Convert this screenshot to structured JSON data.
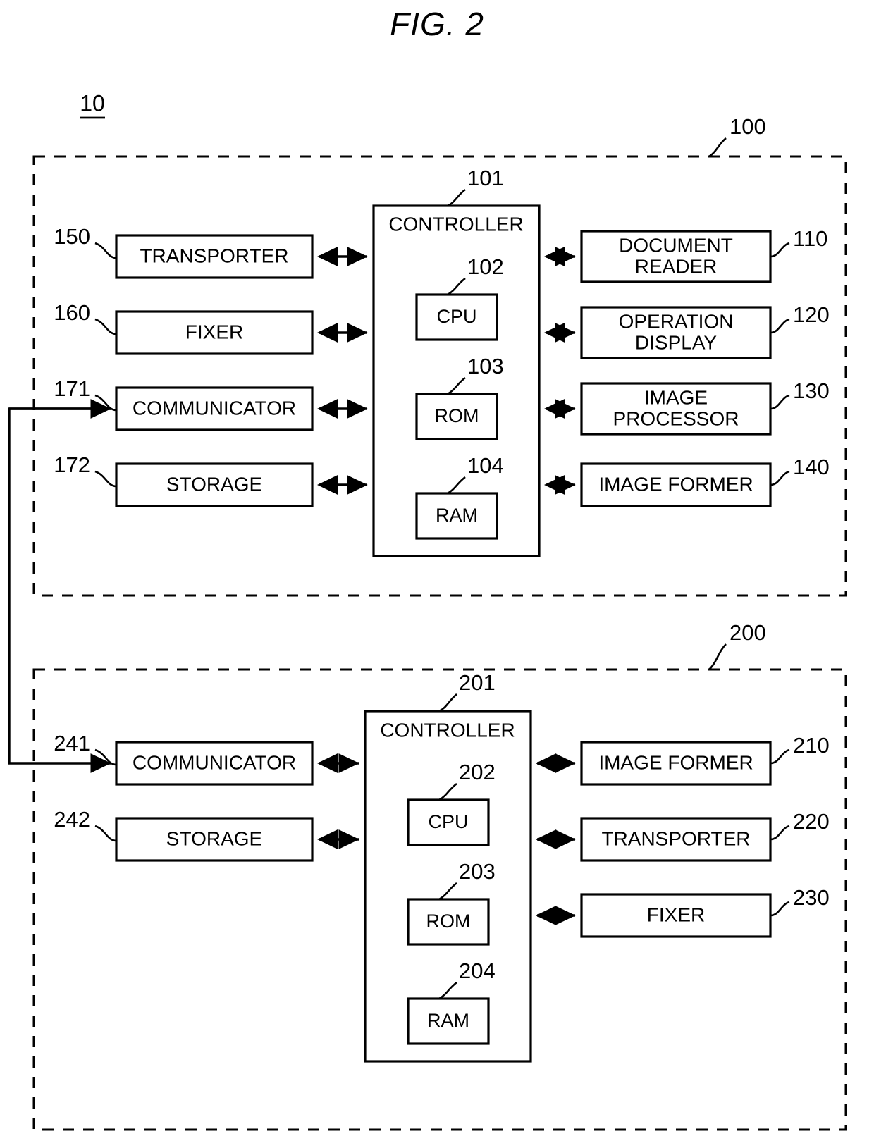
{
  "figure": {
    "title": "FIG. 2",
    "system_label": "10"
  },
  "devices": [
    {
      "id": "100",
      "ref": "100",
      "controller": {
        "ref": "101",
        "title": "CONTROLLER",
        "components": [
          {
            "ref": "102",
            "label": "CPU"
          },
          {
            "ref": "103",
            "label": "ROM"
          },
          {
            "ref": "104",
            "label": "RAM"
          }
        ]
      },
      "left_blocks": [
        {
          "ref": "150",
          "label": "TRANSPORTER"
        },
        {
          "ref": "160",
          "label": "FIXER"
        },
        {
          "ref": "171",
          "label": "COMMUNICATOR"
        },
        {
          "ref": "172",
          "label": "STORAGE"
        }
      ],
      "right_blocks": [
        {
          "ref": "110",
          "label": "DOCUMENT READER",
          "line1": "DOCUMENT",
          "line2": "READER"
        },
        {
          "ref": "120",
          "label": "OPERATION DISPLAY",
          "line1": "OPERATION",
          "line2": "DISPLAY"
        },
        {
          "ref": "130",
          "label": "IMAGE PROCESSOR",
          "line1": "IMAGE",
          "line2": "PROCESSOR"
        },
        {
          "ref": "140",
          "label": "IMAGE FORMER",
          "line1": "IMAGE FORMER",
          "line2": ""
        }
      ]
    },
    {
      "id": "200",
      "ref": "200",
      "controller": {
        "ref": "201",
        "title": "CONTROLLER",
        "components": [
          {
            "ref": "202",
            "label": "CPU"
          },
          {
            "ref": "203",
            "label": "ROM"
          },
          {
            "ref": "204",
            "label": "RAM"
          }
        ]
      },
      "left_blocks": [
        {
          "ref": "241",
          "label": "COMMUNICATOR"
        },
        {
          "ref": "242",
          "label": "STORAGE"
        }
      ],
      "right_blocks": [
        {
          "ref": "210",
          "label": "IMAGE FORMER",
          "line1": "IMAGE FORMER",
          "line2": ""
        },
        {
          "ref": "220",
          "label": "TRANSPORTER",
          "line1": "TRANSPORTER",
          "line2": ""
        },
        {
          "ref": "230",
          "label": "FIXER",
          "line1": "FIXER",
          "line2": ""
        }
      ]
    }
  ],
  "colors": {
    "ink": "#000000",
    "paper": "#ffffff"
  }
}
